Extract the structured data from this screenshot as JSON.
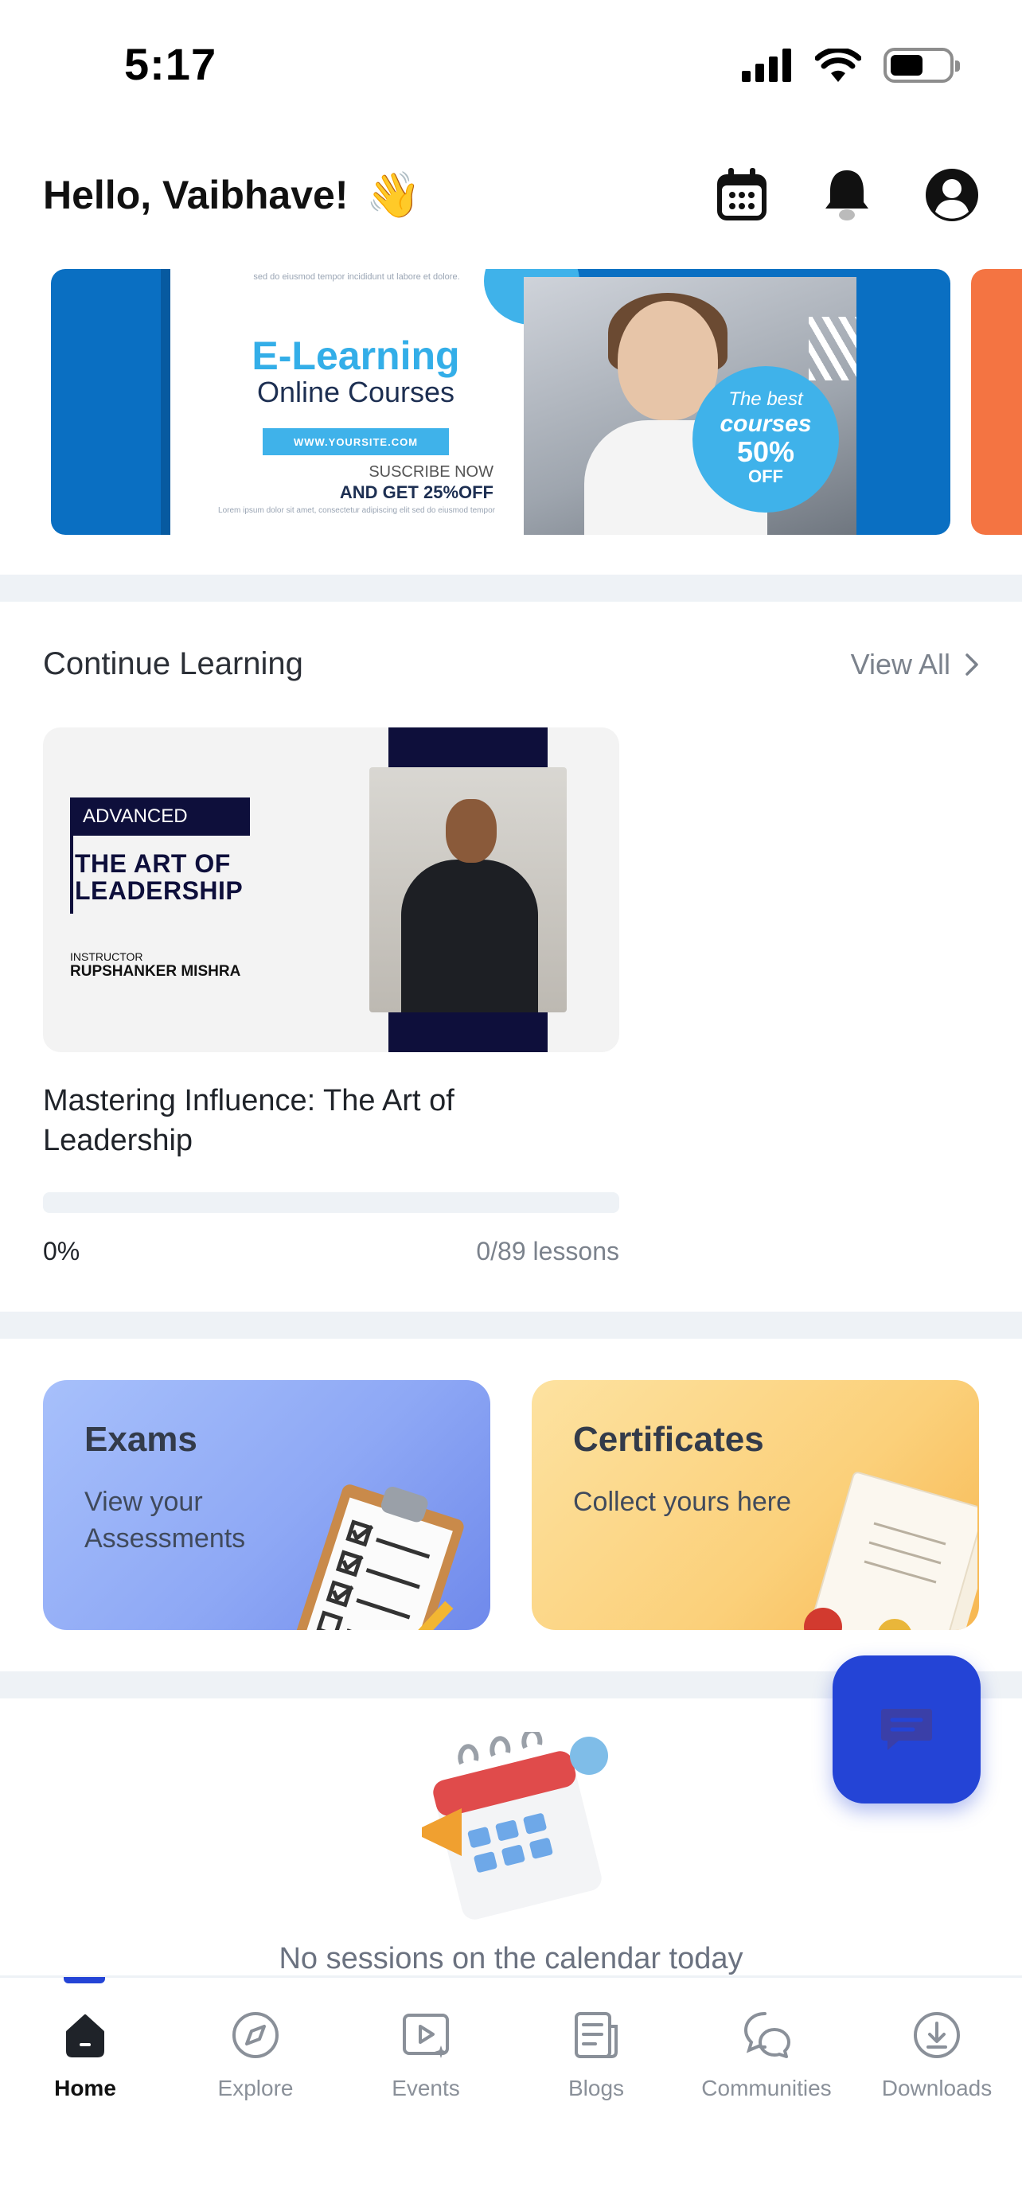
{
  "status_bar": {
    "time": "5:17"
  },
  "header": {
    "greeting": "Hello, Vaibhave!",
    "wave": "👋"
  },
  "banner": {
    "fine_print_top": "sed do eiusmod tempor incididunt ut labore et dolore.",
    "title": "E-Learning",
    "subtitle": "Online Courses",
    "url": "WWW.YOURSITE.COM",
    "cta_line1": "SUSCRIBE NOW",
    "cta_line2": "AND GET  25%OFF",
    "fine_print_bottom": "Lorem ipsum dolor sit amet, consectetur adipiscing elit sed do eiusmod tempor",
    "promo_line1": "The best",
    "promo_line2": "courses",
    "promo_line3": "50%",
    "promo_line4": "OFF"
  },
  "continue_learning": {
    "title": "Continue Learning",
    "view_all": "View All",
    "course": {
      "tag": "ADVANCED",
      "art_title": "THE ART OF LEADERSHIP",
      "instructor_label": "INSTRUCTOR",
      "instructor_name": "RUPSHANKER MISHRA",
      "name": "Mastering Influence: The Art of Leadership",
      "progress_percent": "0%",
      "progress_value": 0,
      "lessons": "0/89 lessons"
    }
  },
  "quick_cards": {
    "exams": {
      "title": "Exams",
      "subtitle": "View your Assessments"
    },
    "certificates": {
      "title": "Certificates",
      "subtitle": "Collect yours here"
    }
  },
  "sessions": {
    "empty_text": "No sessions on the calendar today"
  },
  "bottom_nav": [
    {
      "label": "Home",
      "icon": "home-icon",
      "active": true
    },
    {
      "label": "Explore",
      "icon": "compass-icon"
    },
    {
      "label": "Events",
      "icon": "video-icon"
    },
    {
      "label": "Blogs",
      "icon": "document-icon"
    },
    {
      "label": "Communities",
      "icon": "chat-bubbles-icon"
    },
    {
      "label": "Downloads",
      "icon": "download-icon"
    }
  ],
  "colors": {
    "accent": "#2444d6",
    "banner_blue": "#0a6fc2",
    "banner_orange": "#f47442"
  }
}
